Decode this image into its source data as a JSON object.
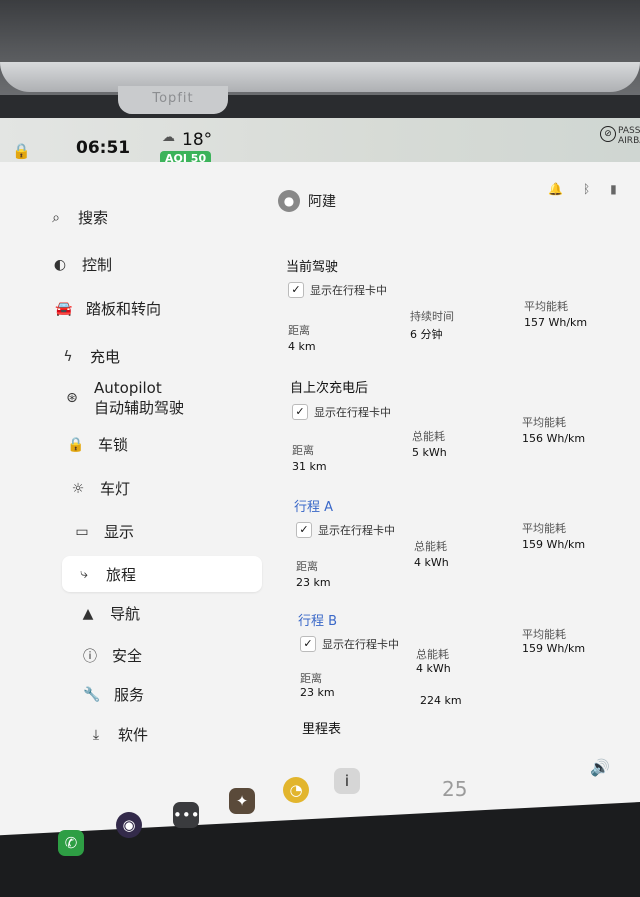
{
  "bezel": {
    "brand": "Topfit"
  },
  "status": {
    "time": "06:51",
    "temperature": "18°",
    "aqi": "AQI 50",
    "airbag": "PASSEN AIRBAG"
  },
  "user": {
    "name": "阿建"
  },
  "sidebar": {
    "items": [
      {
        "label": "搜索",
        "icon": "search-icon"
      },
      {
        "label": "控制",
        "icon": "toggle-icon"
      },
      {
        "label": "踏板和转向",
        "icon": "car-icon"
      },
      {
        "label": "充电",
        "icon": "bolt-icon"
      },
      {
        "label": "Autopilot",
        "label2": "自动辅助驾驶",
        "icon": "steering-wheel-icon"
      },
      {
        "label": "车锁",
        "icon": "lock-icon"
      },
      {
        "label": "车灯",
        "icon": "light-icon"
      },
      {
        "label": "显示",
        "icon": "display-icon"
      },
      {
        "label": "旅程",
        "icon": "trip-icon"
      },
      {
        "label": "导航",
        "icon": "navigation-icon"
      },
      {
        "label": "安全",
        "icon": "safety-icon"
      },
      {
        "label": "服务",
        "icon": "wrench-icon"
      },
      {
        "label": "软件",
        "icon": "download-icon"
      }
    ]
  },
  "trips": {
    "show_in_card": "显示在行程卡中",
    "current": {
      "title": "当前驾驶",
      "distance_label": "距离",
      "distance": "4 km",
      "duration_label": "持续时间",
      "duration": "6 分钟",
      "avg_label": "平均能耗",
      "avg": "157 Wh/km"
    },
    "since_charge": {
      "title": "自上次充电后",
      "distance_label": "距离",
      "distance": "31 km",
      "energy_label": "总能耗",
      "energy": "5 kWh",
      "avg_label": "平均能耗",
      "avg": "156 Wh/km"
    },
    "trip_a": {
      "title": "行程 A",
      "distance_label": "距离",
      "distance": "23 km",
      "energy_label": "总能耗",
      "energy": "4 kWh",
      "avg_label": "平均能耗",
      "avg": "159 Wh/km"
    },
    "trip_b": {
      "title": "行程 B",
      "distance_label": "距离",
      "distance": "23 km",
      "energy_label": "总能耗",
      "energy": "4 kWh",
      "avg_label": "平均能耗",
      "avg": "159 Wh/km"
    },
    "odometer": {
      "title": "里程表",
      "value": "224 km"
    }
  },
  "dock": {
    "cabin_temp": "25"
  },
  "colors": {
    "accent_blue": "#3a68c8",
    "aqi_green": "#3cb35a"
  }
}
